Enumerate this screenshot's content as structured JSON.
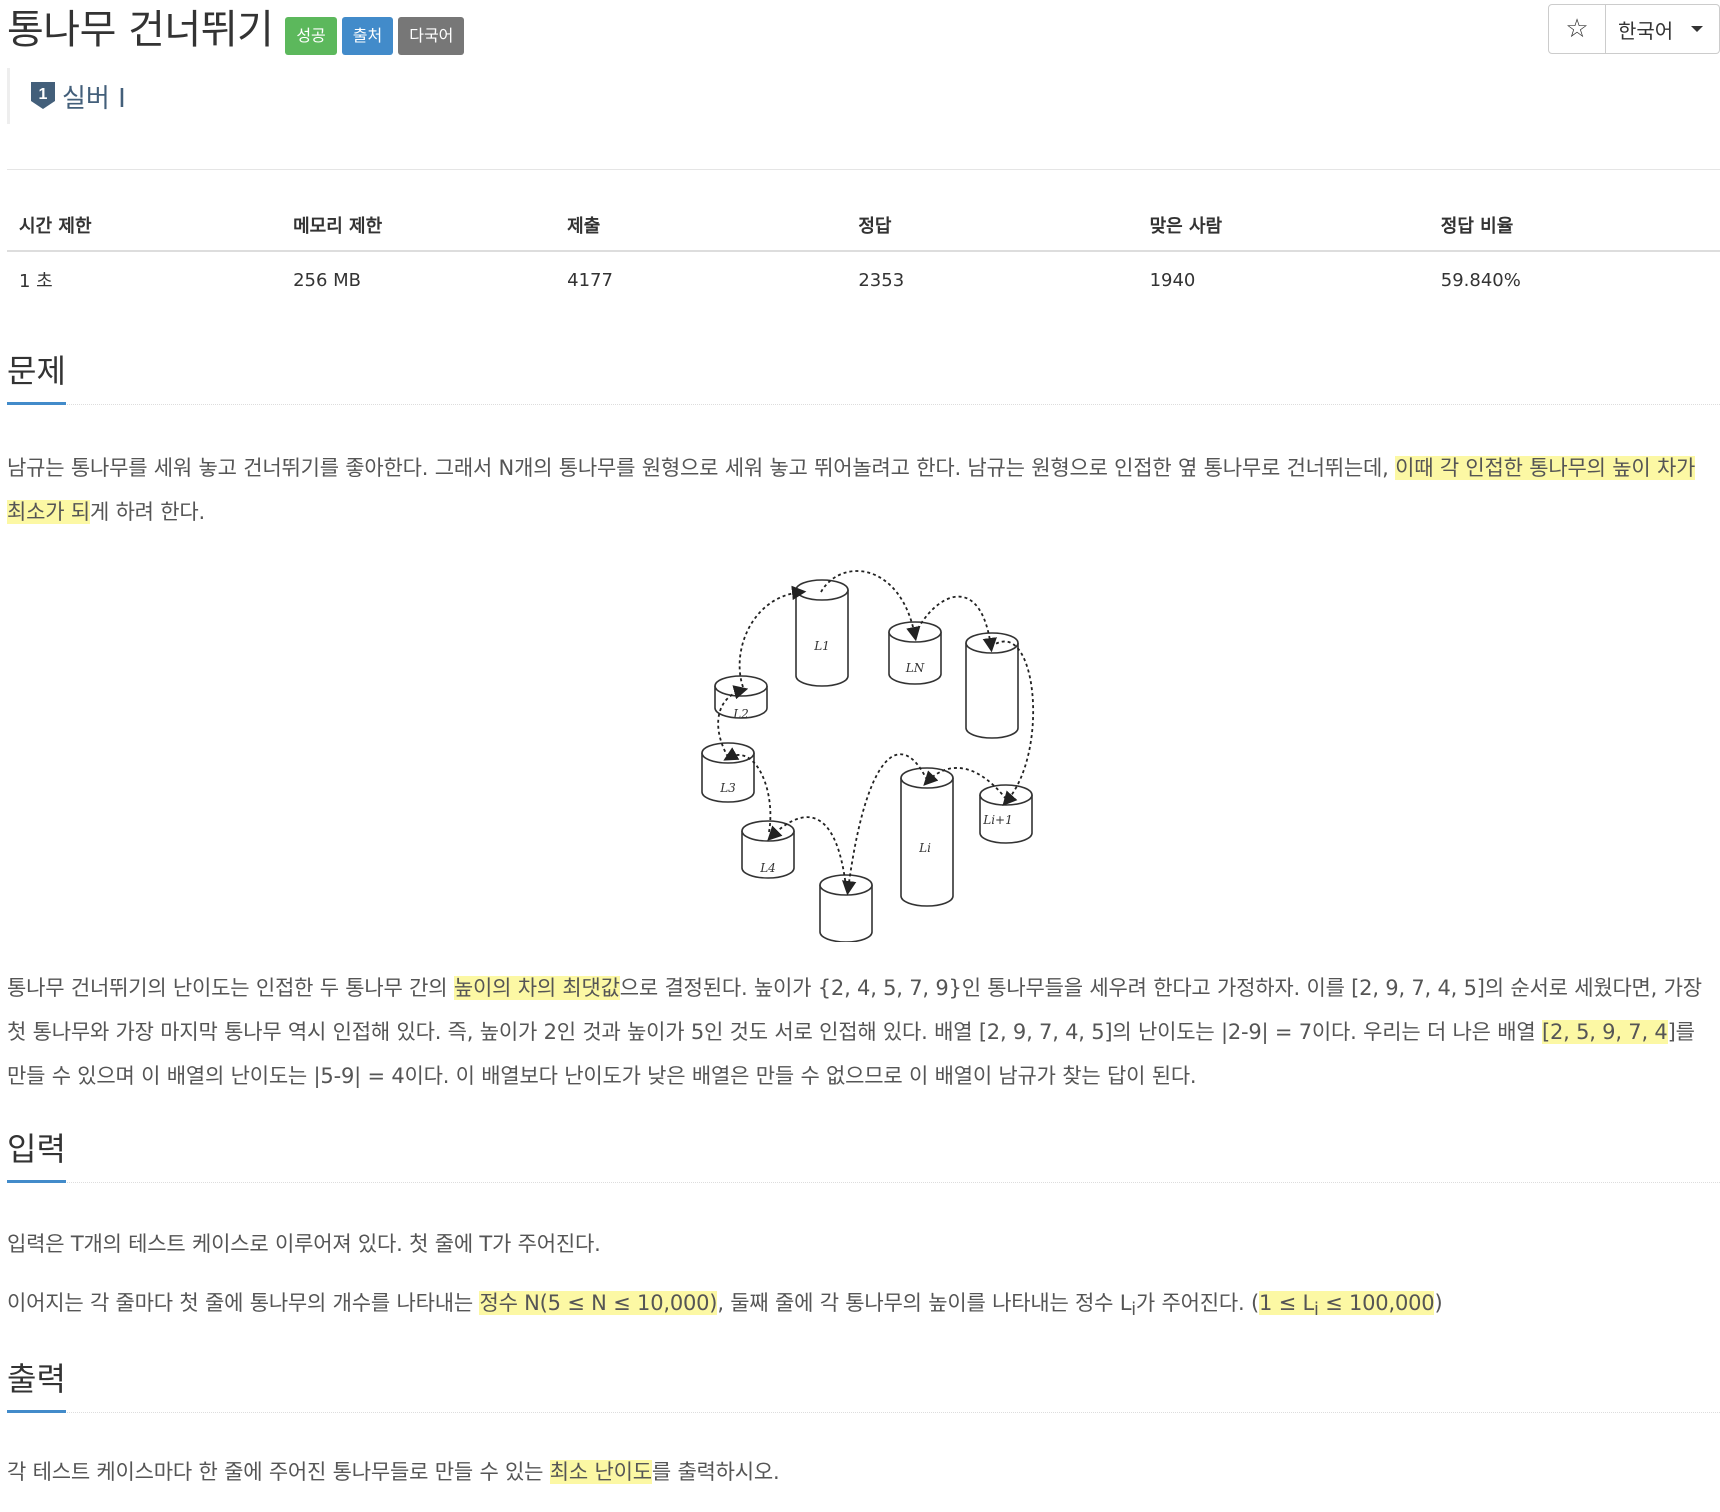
{
  "header": {
    "title": "통나무 건너뛰기",
    "labels": {
      "success": "성공",
      "source": "출처",
      "multilang": "다국어"
    },
    "star_glyph": "☆",
    "language": "한국어"
  },
  "tier": {
    "number": "1",
    "name": "실버 I",
    "color": "#435f7a"
  },
  "stats": {
    "headers": [
      "시간 제한",
      "메모리 제한",
      "제출",
      "정답",
      "맞은 사람",
      "정답 비율"
    ],
    "values": [
      "1 초",
      "256 MB",
      "4177",
      "2353",
      "1940",
      "59.840%"
    ]
  },
  "problem": {
    "heading": "문제",
    "p1": [
      "남규는 통나무를 세워 놓고 건너뛰기를 좋아한다. 그래서 N개의 통나무를 원형으로 세워 놓고 뛰어놀려고 한다. 남규는 원형으로 인접한 옆 통나무로 건너뛰는데, ",
      "이때 각 인접한 통나무의 높이 차가 최소가 되",
      "게 하려 한다."
    ],
    "figure_labels": [
      "L1",
      "LN",
      "L2",
      "L3",
      "L4",
      "Li",
      "Li+1"
    ],
    "p2": [
      "통나무 건너뛰기의 난이도는 인접한 두 통나무 간의 ",
      "높이의 차의 최댓값",
      "으로 결정된다. 높이가 {2, 4, 5, 7, 9}인 통나무들을 세우려 한다고 가정하자. 이를 [2, 9, 7, 4, 5]의 순서로 세웠다면, 가장 첫 통나무와 가장 마지막 통나무 역시 인접해 있다. 즉, 높이가 2인 것과 높이가 5인 것도 서로 인접해 있다. 배열 [2, 9, 7, 4, 5]의 난이도는 |2-9| = 7이다. 우리는 더 나은 배열 ",
      "[2, 5, 9, 7, 4",
      "]를 만들 수 있으며 이 배열의 난이도는 |5-9| = 4이다. 이 배열보다 난이도가 낮은 배열은 만들 수 없으므로 이 배열이 남규가 찾는 답이 된다."
    ]
  },
  "input": {
    "heading": "입력",
    "p1": "입력은 T개의 테스트 케이스로 이루어져 있다. 첫 줄에 T가 주어진다.",
    "p2": [
      "이어지는 각 줄마다 첫 줄에 통나무의 개수를 나타내는 ",
      "정수 N(5 ≤ N ≤ 10,000)",
      ", 둘째 줄에 각 통나무의 높이를 나타내는 정수 L",
      "i",
      "가 주어진다. (",
      "1 ≤ L",
      "i",
      " ≤ 100,000",
      ")"
    ]
  },
  "output": {
    "heading": "출력",
    "p1": [
      "각 테스트 케이스마다 한 줄에 주어진 통나무들로 만들 수 있는 ",
      "최소 난이도",
      "를 출력하시오."
    ]
  },
  "colors": {
    "success": "#5cb85c",
    "source": "#428bca",
    "multilang": "#777777",
    "highlight": "#fcf8a4",
    "heading_underline": "#428bca"
  }
}
